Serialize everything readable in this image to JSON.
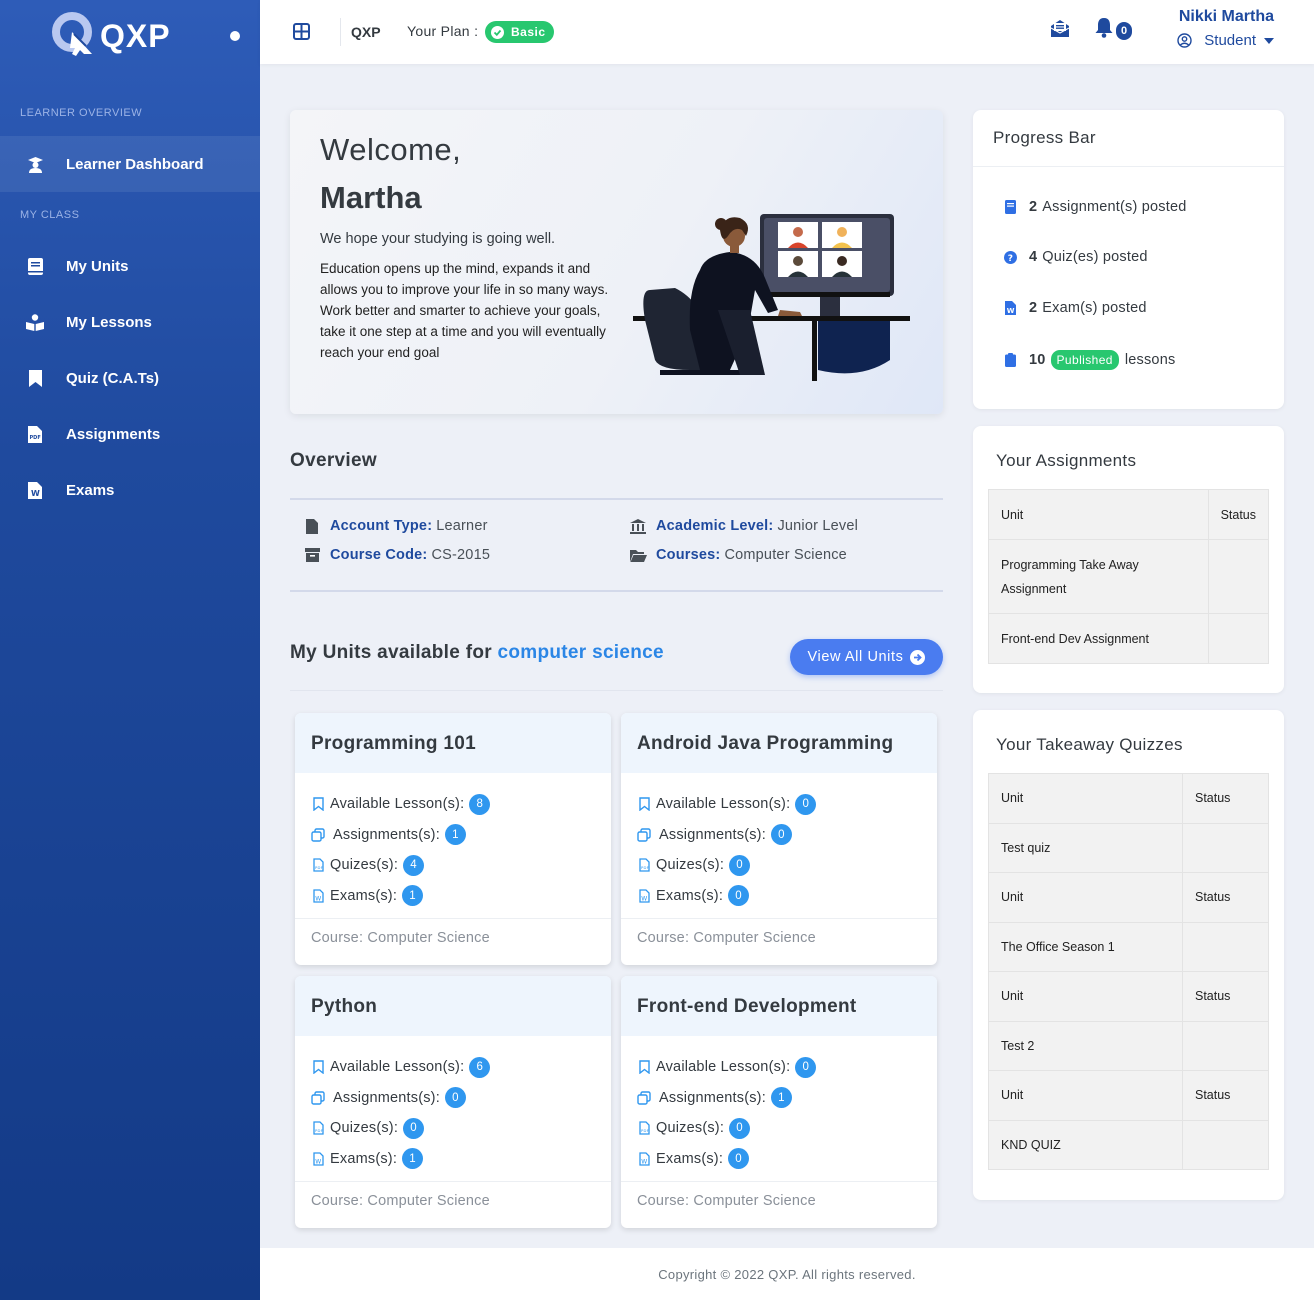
{
  "brand": {
    "logo_text": "QXP"
  },
  "sidebar": {
    "section1": "LEARNER OVERVIEW",
    "dashboard": "Learner Dashboard",
    "section2": "MY CLASS",
    "items": [
      {
        "label": "My Units",
        "icon": "book-icon"
      },
      {
        "label": "My Lessons",
        "icon": "reader-icon"
      },
      {
        "label": "Quiz (C.A.Ts)",
        "icon": "bookmark-icon"
      },
      {
        "label": "Assignments",
        "icon": "pdf-file-icon"
      },
      {
        "label": "Exams",
        "icon": "word-file-icon"
      }
    ]
  },
  "header": {
    "app_name": "QXP",
    "plan_label": "Your Plan :",
    "plan_badge": "Basic",
    "notification_count": "0",
    "user_name": "Nikki Martha",
    "user_role": "Student"
  },
  "welcome": {
    "greeting": "Welcome,",
    "name": "Martha",
    "lead": "We hope your studying is going well.",
    "body": "Education opens up the mind, expands it and allows you to improve your life in so many ways. Work better and smarter to achieve your goals, take it one step at a time and you will eventually reach your end goal"
  },
  "overview": {
    "title": "Overview",
    "account_type_label": "Account Type:",
    "account_type": "Learner",
    "course_code_label": "Course Code:",
    "course_code": "CS-2015",
    "academic_level_label": "Academic Level:",
    "academic_level": "Junior Level",
    "courses_label": "Courses:",
    "courses": "Computer Science"
  },
  "units": {
    "title_prefix": "My Units available for",
    "title_accent": "computer science",
    "view_all": "View All Units",
    "labels": {
      "lessons": "Available Lesson(s):",
      "assignments": "Assignments(s):",
      "quizzes": "Quizes(s):",
      "exams": "Exams(s):"
    },
    "cards": [
      {
        "title": "Programming 101",
        "lessons": "8",
        "assignments": "1",
        "quizzes": "4",
        "exams": "1",
        "course": "Course: Computer Science"
      },
      {
        "title": "Android Java Programming",
        "lessons": "0",
        "assignments": "0",
        "quizzes": "0",
        "exams": "0",
        "course": "Course: Computer Science"
      },
      {
        "title": "Python",
        "lessons": "6",
        "assignments": "0",
        "quizzes": "0",
        "exams": "1",
        "course": "Course: Computer Science"
      },
      {
        "title": "Front-end Development",
        "lessons": "0",
        "assignments": "1",
        "quizzes": "0",
        "exams": "0",
        "course": "Course: Computer Science"
      }
    ]
  },
  "progress": {
    "title": "Progress Bar",
    "assignments_count": "2",
    "assignments_text": "Assignment(s) posted",
    "quizzes_count": "4",
    "quizzes_text": "Quiz(es) posted",
    "exams_count": "2",
    "exams_text": "Exam(s) posted",
    "lessons_count": "10",
    "lessons_badge": "Published",
    "lessons_text": "lessons"
  },
  "assignments_panel": {
    "title": "Your Assignments",
    "col_unit": "Unit",
    "col_status": "Status",
    "rows": [
      {
        "unit": "Programming Take Away Assignment",
        "status": ""
      },
      {
        "unit": "Front-end Dev Assignment",
        "status": ""
      }
    ]
  },
  "quizzes_panel": {
    "title": "Your Takeaway Quizzes",
    "col_unit": "Unit",
    "col_status": "Status",
    "rows": [
      {
        "unit": "Test quiz",
        "status": ""
      },
      {
        "unit": "The Office Season 1",
        "status": ""
      },
      {
        "unit": "Test 2",
        "status": ""
      },
      {
        "unit": "KND QUIZ",
        "status": ""
      }
    ]
  },
  "footer": {
    "text": "Copyright © 2022 QXP. All rights reserved."
  },
  "colors": {
    "sidebar": "#1f4a9e",
    "accent": "#2f97ef",
    "success": "#28c76f",
    "button": "#4a7cf0"
  }
}
